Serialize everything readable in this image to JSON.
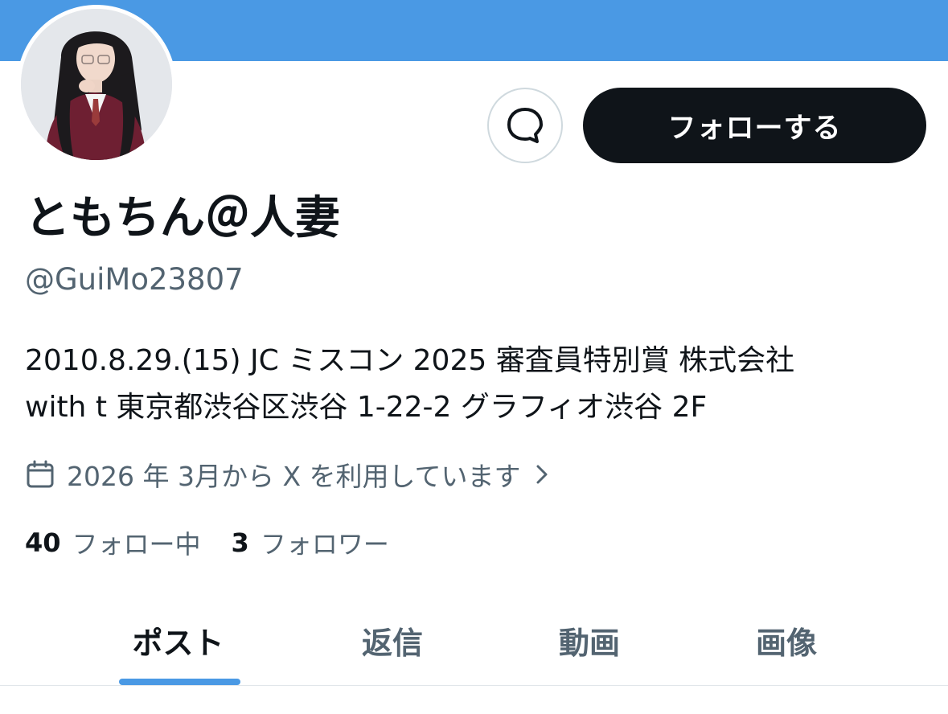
{
  "profile": {
    "display_name": "ともちん＠人妻",
    "handle": "@GuiMo23807",
    "bio_lines": [
      "2010.8.29.(15) JC ミスコン 2025 審査員特別賞 株式会社",
      "with t 東京都渋谷区渋谷 1-22-2 グラフィオ渋谷 2F"
    ],
    "joined": "2026 年 3月から X を利用しています"
  },
  "actions": {
    "follow_label": "フォローする"
  },
  "stats": {
    "following_count": "40",
    "following_label": "フォロー中",
    "followers_count": "3",
    "followers_label": "フォロワー"
  },
  "tabs": [
    {
      "label": "ポスト",
      "active": true
    },
    {
      "label": "返信",
      "active": false
    },
    {
      "label": "動画",
      "active": false
    },
    {
      "label": "画像",
      "active": false
    }
  ],
  "colors": {
    "banner": "#4a99e4",
    "accent": "#4a99e4",
    "follow_button": "#0f1419",
    "secondary_text": "#536471"
  },
  "icons": {
    "message": "message-bubble-icon",
    "joined": "calendar-icon",
    "chevron": "chevron-right-icon"
  }
}
